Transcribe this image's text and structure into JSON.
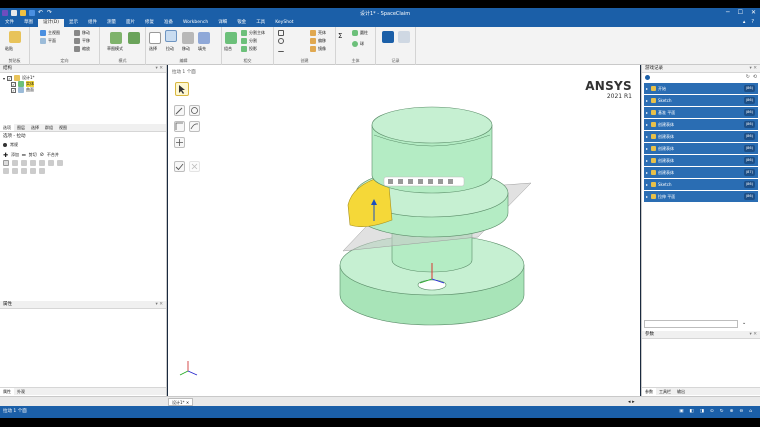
{
  "window": {
    "title": "设计1* - SpaceClaim"
  },
  "menu": {
    "tabs": [
      {
        "label": "文件"
      },
      {
        "label": "草图"
      },
      {
        "label": "设计(D)"
      },
      {
        "label": "显示"
      },
      {
        "label": "组件"
      },
      {
        "label": "测量"
      },
      {
        "label": "面片"
      },
      {
        "label": "修复"
      },
      {
        "label": "准备"
      },
      {
        "label": "Workbench"
      },
      {
        "label": "详细"
      },
      {
        "label": "钣金"
      },
      {
        "label": "工具"
      },
      {
        "label": "KeyShot"
      }
    ],
    "active_index": 2
  },
  "ribbon": {
    "clipboard": {
      "paste": "粘贴",
      "label": "剪贴板"
    },
    "orient": {
      "home": "主视图",
      "plane": "平面",
      "pan": "移动",
      "rotate": "平移",
      "zoom": "缩放",
      "label": "定向"
    },
    "mode": {
      "sketch": "草图模式",
      "label": "模式"
    },
    "edit": {
      "select": "选择",
      "pull": "拉动",
      "move": "移动",
      "fill": "填充",
      "label": "编辑"
    },
    "intersect": {
      "combine": "组合",
      "split_body": "分割主体",
      "split": "分割",
      "project": "投影",
      "label": "相交"
    },
    "create": {
      "shell": "壳体",
      "offset": "偏移",
      "mirror": "镜像",
      "label": "创建"
    },
    "body": {
      "cylinder": "圆柱",
      "sphere": "球",
      "label": "主体"
    },
    "assembly": {
      "label": "记录"
    },
    "accent": "#1b5fa8"
  },
  "left_panel": {
    "structure_title": "结构",
    "tree": [
      {
        "label": "设计1*"
      },
      {
        "label": "实体"
      },
      {
        "label": "曲面"
      }
    ],
    "tabs": [
      {
        "label": "选项"
      },
      {
        "label": "图层"
      },
      {
        "label": "选择"
      },
      {
        "label": "群组"
      },
      {
        "label": "视图"
      }
    ],
    "options_title": "选项 - 拉动",
    "option_rows": [
      {
        "label": "常规"
      }
    ],
    "option_mode": {
      "add": "添加",
      "cut": "剪切",
      "none": "不合并"
    },
    "properties_title": "属性",
    "bottom_tabs": [
      {
        "label": "属性"
      },
      {
        "label": "外观"
      }
    ]
  },
  "viewport": {
    "breadcrumb": "拉动 1 个面",
    "brand_name": "ANSYS",
    "brand_version": "2021 R1"
  },
  "right_panel": {
    "title": "游戏记录",
    "items": [
      {
        "label": "开始",
        "count": "(86)"
      },
      {
        "label": "Sketch",
        "count": "(86)"
      },
      {
        "label": "基准 平面",
        "count": "(86)"
      },
      {
        "label": "创建表体",
        "count": "(86)"
      },
      {
        "label": "创建表体",
        "count": "(86)"
      },
      {
        "label": "创建表体",
        "count": "(86)"
      },
      {
        "label": "创建表体",
        "count": "(86)"
      },
      {
        "label": "创建表体",
        "count": "(87)"
      },
      {
        "label": "Sketch",
        "count": "(86)"
      },
      {
        "label": "拉伸 平面",
        "count": "(86)"
      }
    ],
    "params_title": "参数",
    "bottom_tabs": [
      {
        "label": "参数"
      },
      {
        "label": "工具栏"
      },
      {
        "label": "输出"
      }
    ]
  },
  "bottom": {
    "doc_tab": "设计1*",
    "status_text": "拉动 1 个面"
  },
  "colors": {
    "body": "#b8ecc8",
    "selected_face": "#f5d838",
    "plane": "#c9c9c9",
    "accent": "#1b5fa8"
  }
}
